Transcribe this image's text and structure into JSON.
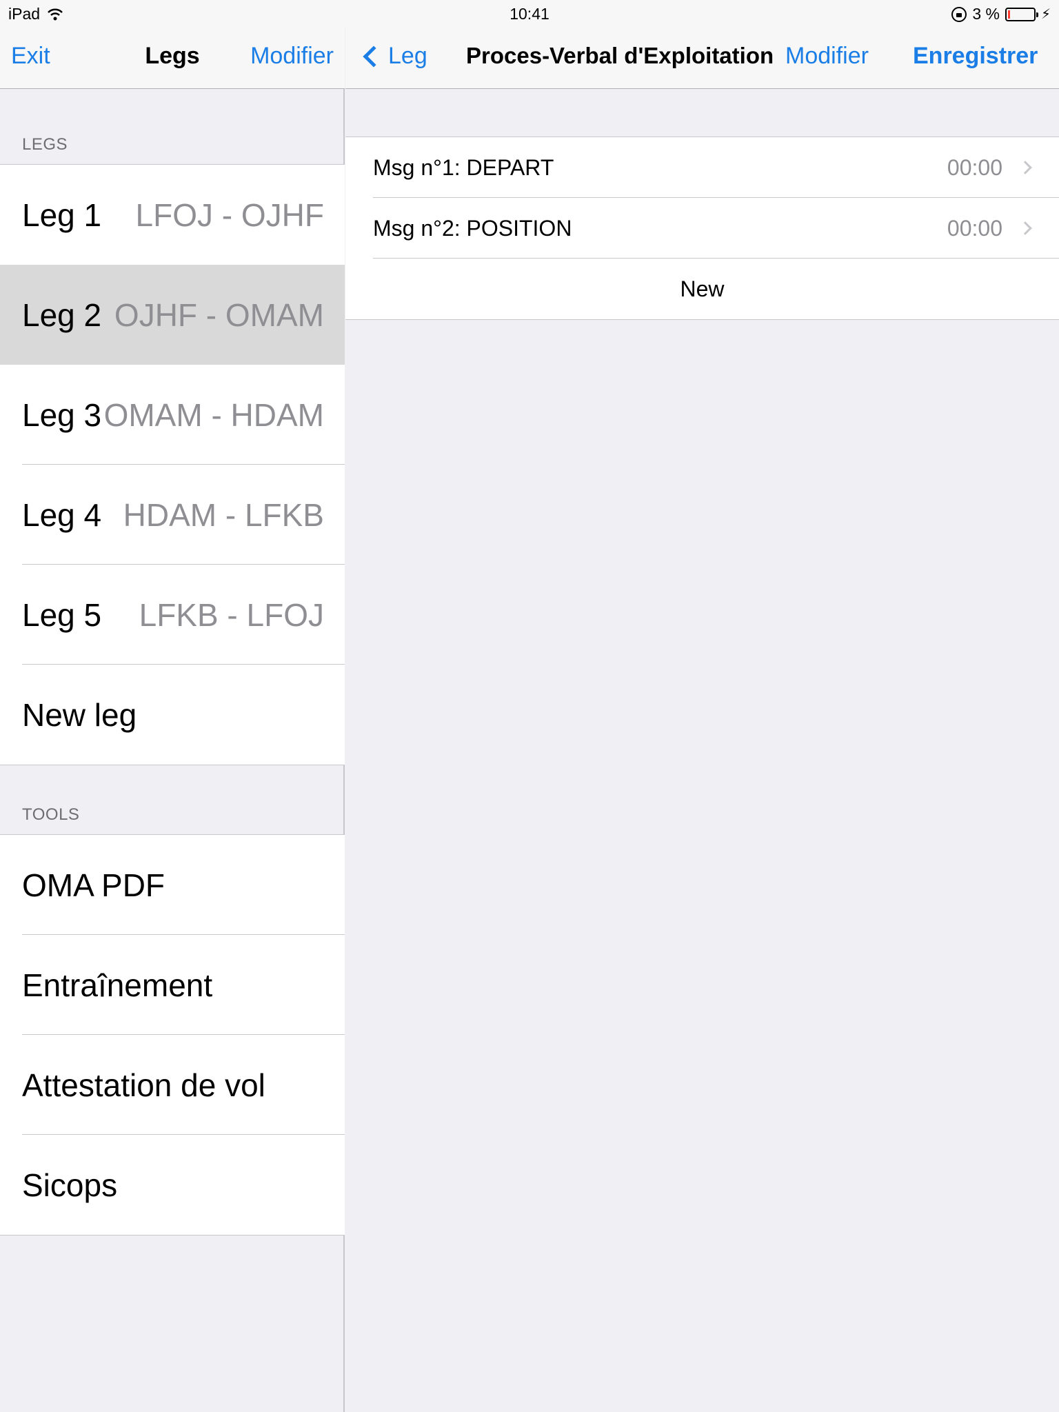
{
  "status_bar": {
    "device": "iPad",
    "time": "10:41",
    "battery_text": "3 %"
  },
  "left": {
    "nav": {
      "exit_label": "Exit",
      "title": "Legs",
      "modifier_label": "Modifier"
    },
    "legs_header": "LEGS",
    "legs": [
      {
        "label": "Leg 1",
        "route": "LFOJ - OJHF",
        "selected": false
      },
      {
        "label": "Leg 2",
        "route": "OJHF - OMAM",
        "selected": true
      },
      {
        "label": "Leg 3",
        "route": "OMAM - HDAM",
        "selected": false
      },
      {
        "label": "Leg 4",
        "route": "HDAM - LFKB",
        "selected": false
      },
      {
        "label": "Leg 5",
        "route": "LFKB - LFOJ",
        "selected": false
      }
    ],
    "new_leg_label": "New leg",
    "tools_header": "TOOLS",
    "tools": [
      {
        "label": "OMA PDF"
      },
      {
        "label": "Entraînement"
      },
      {
        "label": "Attestation de vol"
      },
      {
        "label": "Sicops"
      }
    ]
  },
  "right": {
    "nav": {
      "back_label": "Leg",
      "title": "Proces-Verbal d'Exploitation",
      "modifier_label": "Modifier",
      "save_label": "Enregistrer"
    },
    "messages": [
      {
        "label": "Msg n°1: DEPART",
        "time": "00:00"
      },
      {
        "label": "Msg n°2: POSITION",
        "time": "00:00"
      }
    ],
    "new_label": "New"
  },
  "colors": {
    "accent": "#1a7ee6",
    "background": "#efeff4",
    "selected_row": "#d9d9d9",
    "secondary_text": "#8e8e93"
  }
}
